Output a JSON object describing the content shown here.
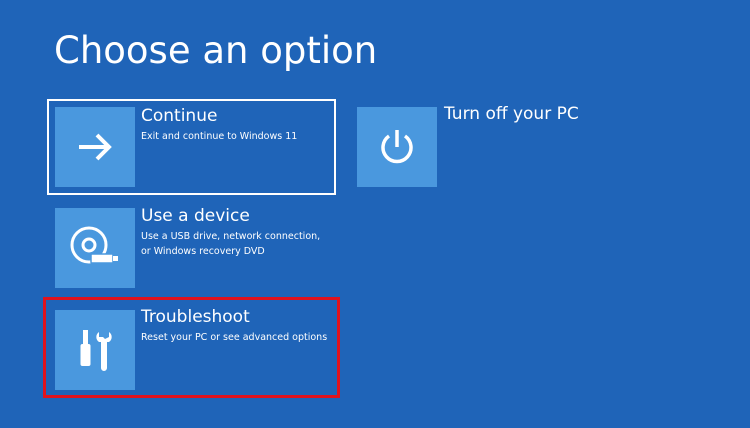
{
  "page": {
    "title": "Choose an option",
    "background": "#1f64b8",
    "tile_color": "#4a98de",
    "highlight_color": "#e0131e"
  },
  "options": [
    {
      "label": "Continue",
      "description": "Exit and continue to Windows 11",
      "icon": "arrow-right-icon"
    },
    {
      "label": "Use a device",
      "description": "Use a USB drive, network connection, or Windows recovery DVD",
      "icon": "disc-usb-icon"
    },
    {
      "label": "Troubleshoot",
      "description": "Reset your PC or see advanced options",
      "icon": "tools-icon"
    },
    {
      "label": "Turn off your PC",
      "description": "",
      "icon": "power-icon"
    }
  ]
}
